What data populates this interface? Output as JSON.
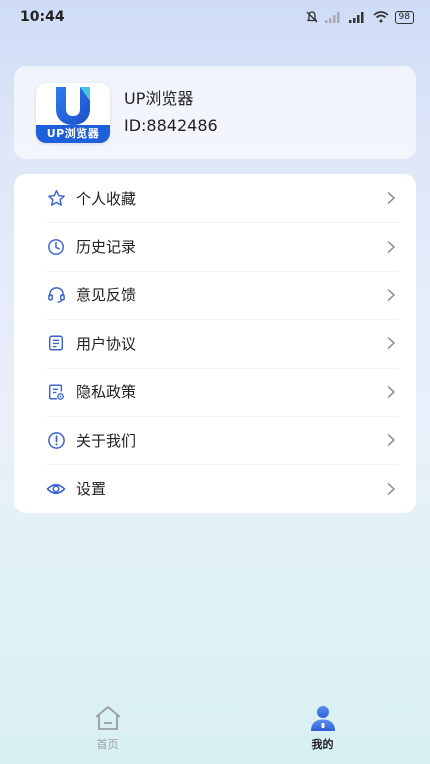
{
  "status_bar": {
    "time": "10:44",
    "battery": "98"
  },
  "profile": {
    "logo_text": "UP浏览器",
    "name": "UP浏览器",
    "id_text": "ID:8842486"
  },
  "menu": {
    "items": [
      {
        "label": "个人收藏",
        "icon": "star-icon"
      },
      {
        "label": "历史记录",
        "icon": "clock-icon"
      },
      {
        "label": "意见反馈",
        "icon": "headset-icon"
      },
      {
        "label": "用户协议",
        "icon": "document-icon"
      },
      {
        "label": "隐私政策",
        "icon": "privacy-doc-icon"
      },
      {
        "label": "关于我们",
        "icon": "info-icon"
      },
      {
        "label": "设置",
        "icon": "settings-icon"
      }
    ]
  },
  "tabs": [
    {
      "label": "首页",
      "icon": "home-icon",
      "active": false
    },
    {
      "label": "我的",
      "icon": "profile-icon",
      "active": true
    }
  ],
  "colors": {
    "accent": "#3b63c9",
    "brand": "#1d5fd8",
    "inactive": "#9a9ea6"
  }
}
